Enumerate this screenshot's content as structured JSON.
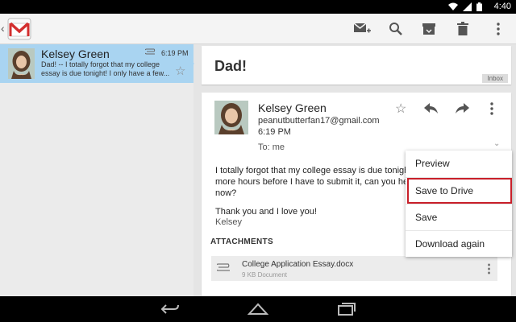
{
  "status_bar": {
    "time": "4:40",
    "icons": [
      "wifi-icon",
      "signal-icon",
      "battery-icon"
    ]
  },
  "action_bar": {
    "app": "Gmail",
    "actions": [
      "compose-icon",
      "search-icon",
      "archive-icon",
      "delete-icon",
      "overflow-icon"
    ]
  },
  "conversation_list": {
    "items": [
      {
        "sender": "Kelsey Green",
        "time": "6:19 PM",
        "snippet": "Dad! -- I totally forgot that my college essay is due tonight! I only have a few...",
        "has_attachment": true,
        "selected": true
      }
    ]
  },
  "thread": {
    "subject": "Dad!",
    "label": "Inbox",
    "message": {
      "sender": "Kelsey Green",
      "email": "peanutbutterfan17@gmail.com",
      "time": "6:19 PM",
      "to": "To: me",
      "body_lines": [
        "I totally forgot that my college essay is due tonigh",
        "more hours before I have to submit it, can you he",
        "now?"
      ],
      "thanks": "Thank you and I love you!",
      "signature": "Kelsey",
      "attachments_heading": "ATTACHMENTS",
      "attachment": {
        "name": "College Application Essay.docx",
        "size": "9 KB Document"
      }
    }
  },
  "popup_menu": {
    "items": [
      "Preview",
      "Save to Drive",
      "Save",
      "Download again"
    ],
    "highlighted": "Save to Drive",
    "highlight_color": "#c8202a"
  },
  "colors": {
    "selected_row": "#a9d4f1",
    "background": "#e5e5e5"
  }
}
